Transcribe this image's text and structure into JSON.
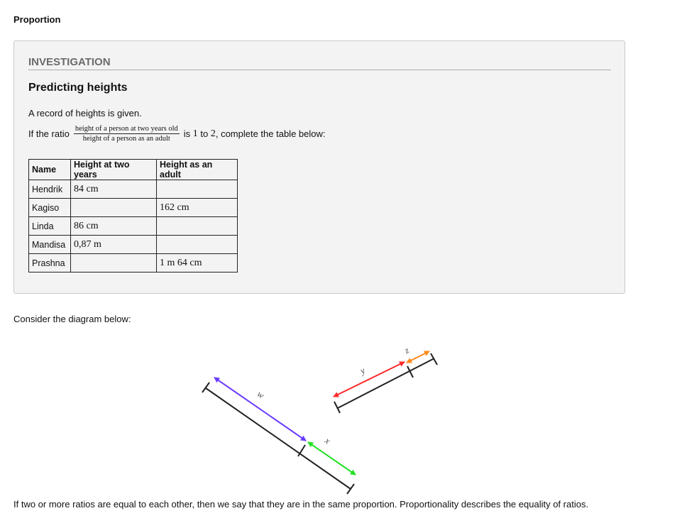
{
  "page": {
    "title": "Proportion"
  },
  "investigation": {
    "label": "INVESTIGATION",
    "heading": "Predicting heights",
    "intro": "A record of heights is given.",
    "ratio": {
      "prefix": "If the ratio",
      "numerator": "height of a person at two years old",
      "denominator": "height of a person as an adult",
      "is_text": "is",
      "a": "1",
      "to_text": "to",
      "b": "2",
      "suffix": ", complete the table below:"
    },
    "table": {
      "headers": [
        "Name",
        "Height at two years",
        "Height as an adult"
      ],
      "rows": [
        [
          "Hendrik",
          "84 cm",
          ""
        ],
        [
          "Kagiso",
          "",
          "162 cm"
        ],
        [
          "Linda",
          "86 cm",
          ""
        ],
        [
          "Mandisa",
          "0,87 m",
          ""
        ],
        [
          "Prashna",
          "",
          "1 m 64 cm"
        ]
      ]
    }
  },
  "consider_text": "Consider the diagram below:",
  "diagram": {
    "labels": {
      "w": "w",
      "x": "x",
      "y": "y",
      "z": "z"
    },
    "colors": {
      "w": "#6a3cff",
      "x": "#22e022",
      "y": "#ff2a2a",
      "z": "#ff8a1a",
      "line": "#222222"
    }
  },
  "footer_text": "If two or more ratios are equal to each other, then we say that they are in the same proportion. Proportionality describes the equality of ratios."
}
